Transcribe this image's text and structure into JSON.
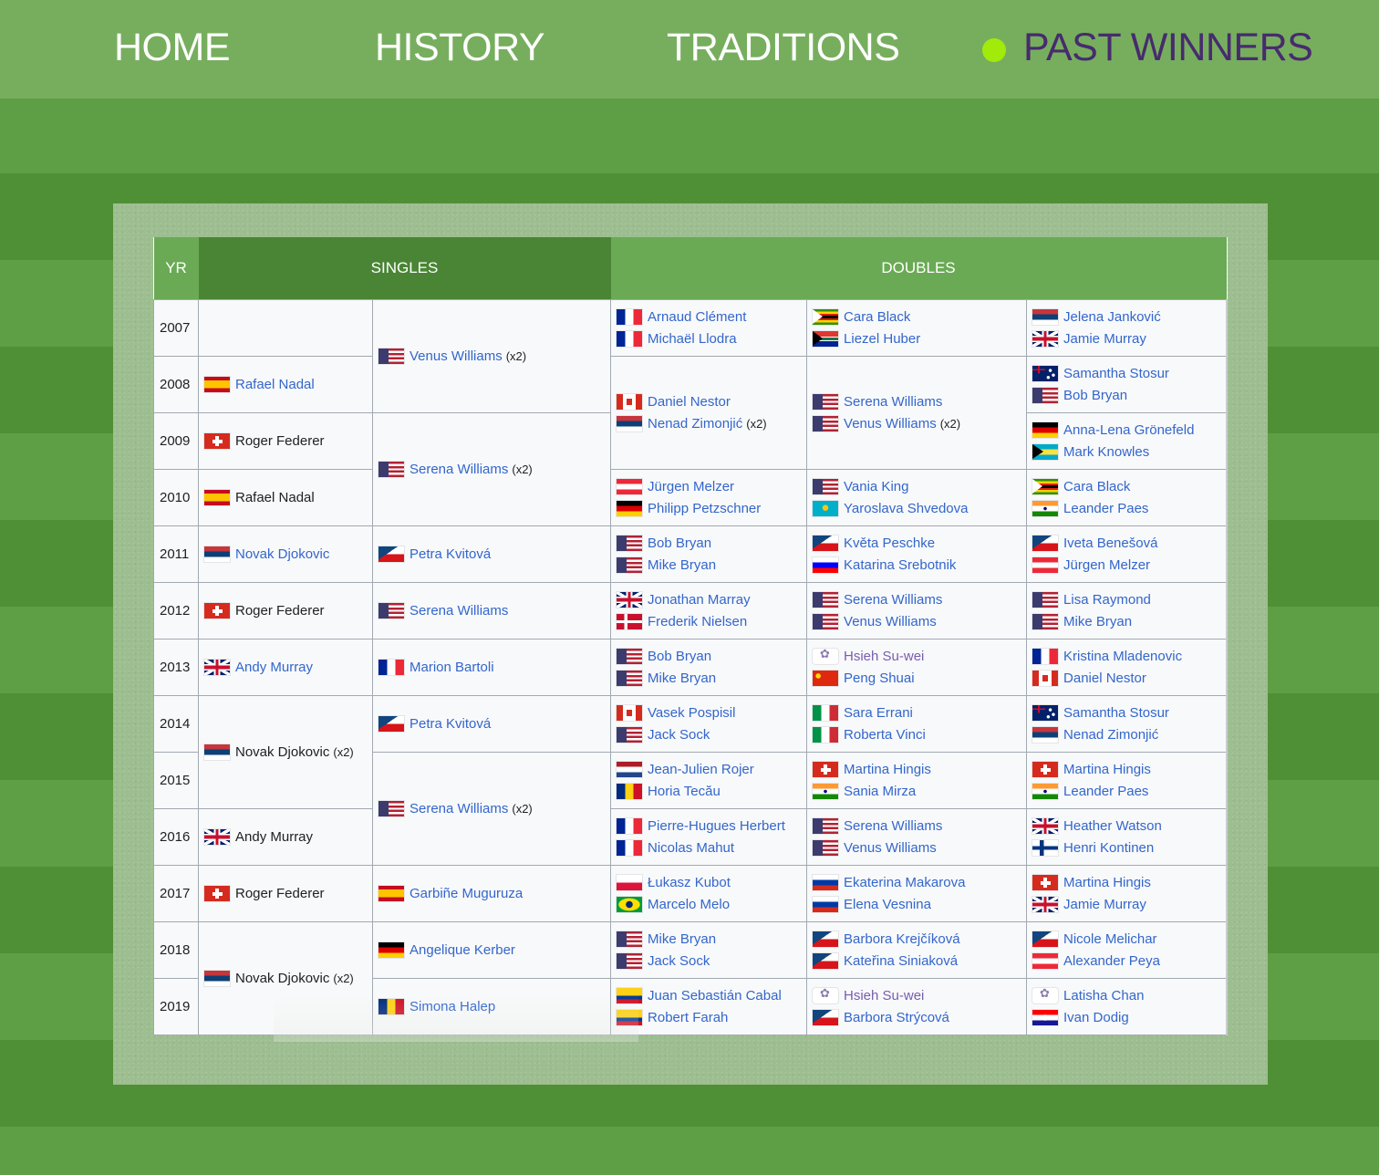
{
  "nav": {
    "home": "HOME",
    "history": "HISTORY",
    "traditions": "TRADITIONS",
    "past_winners": "PAST WINNERS",
    "active_color": "#472b6e",
    "dot_color": "#a2ea0a"
  },
  "table": {
    "headers": {
      "yr": "YR",
      "singles": "SINGLES",
      "doubles": "DOUBLES"
    },
    "rows": [
      {
        "year": "2007",
        "m": null,
        "w": {
          "flag": "us",
          "name": "Venus Williams",
          "mult": "(x2)",
          "link": true
        },
        "md": [
          {
            "flag": "fr",
            "name": "Arnaud Clément"
          },
          {
            "flag": "fr",
            "name": "Michaël Llodra"
          }
        ],
        "wd": [
          {
            "flag": "zw",
            "name": "Cara Black"
          },
          {
            "flag": "za",
            "name": "Liezel Huber"
          }
        ],
        "xd": [
          {
            "flag": "rs",
            "name": "Jelena Janković"
          },
          {
            "flag": "gb",
            "name": "Jamie Murray"
          }
        ]
      },
      {
        "year": "2008",
        "m": {
          "flag": "es",
          "name": "Rafael Nadal",
          "link": true
        },
        "md": [
          {
            "flag": "ca",
            "name": "Daniel Nestor"
          },
          {
            "flag": "rs",
            "name": "Nenad Zimonjić",
            "mult": "(x2)"
          }
        ],
        "wd": [
          {
            "flag": "us",
            "name": "Serena Williams"
          },
          {
            "flag": "us",
            "name": "Venus Williams",
            "mult": "(x2)"
          }
        ],
        "xd": [
          {
            "flag": "au",
            "name": "Samantha Stosur"
          },
          {
            "flag": "us",
            "name": "Bob Bryan"
          }
        ]
      },
      {
        "year": "2009",
        "m": {
          "flag": "ch",
          "name": "Roger Federer",
          "link": false
        },
        "w": {
          "flag": "us",
          "name": "Serena Williams",
          "mult": "(x2)",
          "link": true
        },
        "xd": [
          {
            "flag": "de",
            "name": "Anna-Lena Grönefeld"
          },
          {
            "flag": "bs",
            "name": "Mark Knowles"
          }
        ]
      },
      {
        "year": "2010",
        "m": {
          "flag": "es",
          "name": "Rafael Nadal",
          "link": false
        },
        "md": [
          {
            "flag": "at",
            "name": "Jürgen Melzer"
          },
          {
            "flag": "de",
            "name": "Philipp Petzschner"
          }
        ],
        "wd": [
          {
            "flag": "us",
            "name": "Vania King"
          },
          {
            "flag": "kz",
            "name": "Yaroslava Shvedova"
          }
        ],
        "xd": [
          {
            "flag": "zw",
            "name": "Cara Black"
          },
          {
            "flag": "in",
            "name": "Leander Paes"
          }
        ]
      },
      {
        "year": "2011",
        "m": {
          "flag": "rs",
          "name": "Novak Djokovic",
          "link": true
        },
        "w": {
          "flag": "cz",
          "name": "Petra Kvitová",
          "link": true
        },
        "md": [
          {
            "flag": "us",
            "name": "Bob Bryan"
          },
          {
            "flag": "us",
            "name": "Mike Bryan"
          }
        ],
        "wd": [
          {
            "flag": "cz",
            "name": "Květa Peschke"
          },
          {
            "flag": "si",
            "name": "Katarina Srebotnik"
          }
        ],
        "xd": [
          {
            "flag": "cz",
            "name": "Iveta Benešová"
          },
          {
            "flag": "at",
            "name": "Jürgen Melzer"
          }
        ]
      },
      {
        "year": "2012",
        "m": {
          "flag": "ch",
          "name": "Roger Federer",
          "link": false
        },
        "w": {
          "flag": "us",
          "name": "Serena Williams",
          "link": true
        },
        "md": [
          {
            "flag": "gb",
            "name": "Jonathan Marray"
          },
          {
            "flag": "dk",
            "name": "Frederik Nielsen"
          }
        ],
        "wd": [
          {
            "flag": "us",
            "name": "Serena Williams"
          },
          {
            "flag": "us",
            "name": "Venus Williams"
          }
        ],
        "xd": [
          {
            "flag": "us",
            "name": "Lisa Raymond"
          },
          {
            "flag": "us",
            "name": "Mike Bryan"
          }
        ]
      },
      {
        "year": "2013",
        "m": {
          "flag": "gb",
          "name": "Andy Murray",
          "link": true
        },
        "w": {
          "flag": "fr",
          "name": "Marion Bartoli",
          "link": true
        },
        "md": [
          {
            "flag": "us",
            "name": "Bob Bryan"
          },
          {
            "flag": "us",
            "name": "Mike Bryan"
          }
        ],
        "wd": [
          {
            "flag": "tpe",
            "name": "Hsieh Su-wei",
            "visited": true
          },
          {
            "flag": "cn",
            "name": "Peng Shuai"
          }
        ],
        "xd": [
          {
            "flag": "fr",
            "name": "Kristina Mladenovic"
          },
          {
            "flag": "ca",
            "name": "Daniel Nestor"
          }
        ]
      },
      {
        "year": "2014",
        "m": {
          "flag": "rs",
          "name": "Novak Djokovic",
          "mult": "(x2)",
          "link": false
        },
        "w": {
          "flag": "cz",
          "name": "Petra Kvitová",
          "link": true
        },
        "md": [
          {
            "flag": "ca",
            "name": "Vasek Pospisil"
          },
          {
            "flag": "us",
            "name": "Jack Sock"
          }
        ],
        "wd": [
          {
            "flag": "it",
            "name": "Sara Errani"
          },
          {
            "flag": "it",
            "name": "Roberta Vinci"
          }
        ],
        "xd": [
          {
            "flag": "au",
            "name": "Samantha Stosur"
          },
          {
            "flag": "rs",
            "name": "Nenad Zimonjić"
          }
        ]
      },
      {
        "year": "2015",
        "w": {
          "flag": "us",
          "name": "Serena Williams",
          "mult": "(x2)",
          "link": true
        },
        "md": [
          {
            "flag": "nl",
            "name": "Jean-Julien Rojer"
          },
          {
            "flag": "ro",
            "name": "Horia Tecău"
          }
        ],
        "wd": [
          {
            "flag": "ch",
            "name": "Martina Hingis"
          },
          {
            "flag": "in",
            "name": "Sania Mirza"
          }
        ],
        "xd": [
          {
            "flag": "ch",
            "name": "Martina Hingis"
          },
          {
            "flag": "in",
            "name": "Leander Paes"
          }
        ]
      },
      {
        "year": "2016",
        "m": {
          "flag": "gb",
          "name": "Andy Murray",
          "link": false
        },
        "md": [
          {
            "flag": "fr",
            "name": "Pierre-Hugues Herbert"
          },
          {
            "flag": "fr",
            "name": "Nicolas Mahut"
          }
        ],
        "wd": [
          {
            "flag": "us",
            "name": "Serena Williams"
          },
          {
            "flag": "us",
            "name": "Venus Williams"
          }
        ],
        "xd": [
          {
            "flag": "gb",
            "name": "Heather Watson"
          },
          {
            "flag": "fi",
            "name": "Henri Kontinen"
          }
        ]
      },
      {
        "year": "2017",
        "m": {
          "flag": "ch",
          "name": "Roger Federer",
          "link": false
        },
        "w": {
          "flag": "es",
          "name": "Garbiñe Muguruza",
          "link": true
        },
        "md": [
          {
            "flag": "pl",
            "name": "Łukasz Kubot"
          },
          {
            "flag": "br",
            "name": "Marcelo Melo"
          }
        ],
        "wd": [
          {
            "flag": "ru",
            "name": "Ekaterina Makarova"
          },
          {
            "flag": "ru",
            "name": "Elena Vesnina"
          }
        ],
        "xd": [
          {
            "flag": "ch",
            "name": "Martina Hingis"
          },
          {
            "flag": "gb",
            "name": "Jamie Murray"
          }
        ]
      },
      {
        "year": "2018",
        "m": {
          "flag": "rs",
          "name": "Novak Djokovic",
          "mult": "(x2)",
          "link": false
        },
        "w": {
          "flag": "de",
          "name": "Angelique Kerber",
          "link": true
        },
        "md": [
          {
            "flag": "us",
            "name": "Mike Bryan"
          },
          {
            "flag": "us",
            "name": "Jack Sock"
          }
        ],
        "wd": [
          {
            "flag": "cz",
            "name": "Barbora Krejčíková"
          },
          {
            "flag": "cz",
            "name": "Kateřina Siniaková"
          }
        ],
        "xd": [
          {
            "flag": "cz",
            "name": "Nicole Melichar"
          },
          {
            "flag": "at",
            "name": "Alexander Peya"
          }
        ]
      },
      {
        "year": "2019",
        "w": {
          "flag": "ro",
          "name": "Simona Halep",
          "link": true
        },
        "md": [
          {
            "flag": "co",
            "name": "Juan Sebastián Cabal"
          },
          {
            "flag": "co",
            "name": "Robert Farah"
          }
        ],
        "wd": [
          {
            "flag": "tpe",
            "name": "Hsieh Su-wei",
            "visited": true
          },
          {
            "flag": "cz",
            "name": "Barbora Strýcová"
          }
        ],
        "xd": [
          {
            "flag": "tpe",
            "name": "Latisha Chan"
          },
          {
            "flag": "hr",
            "name": "Ivan Dodig"
          }
        ]
      }
    ]
  }
}
